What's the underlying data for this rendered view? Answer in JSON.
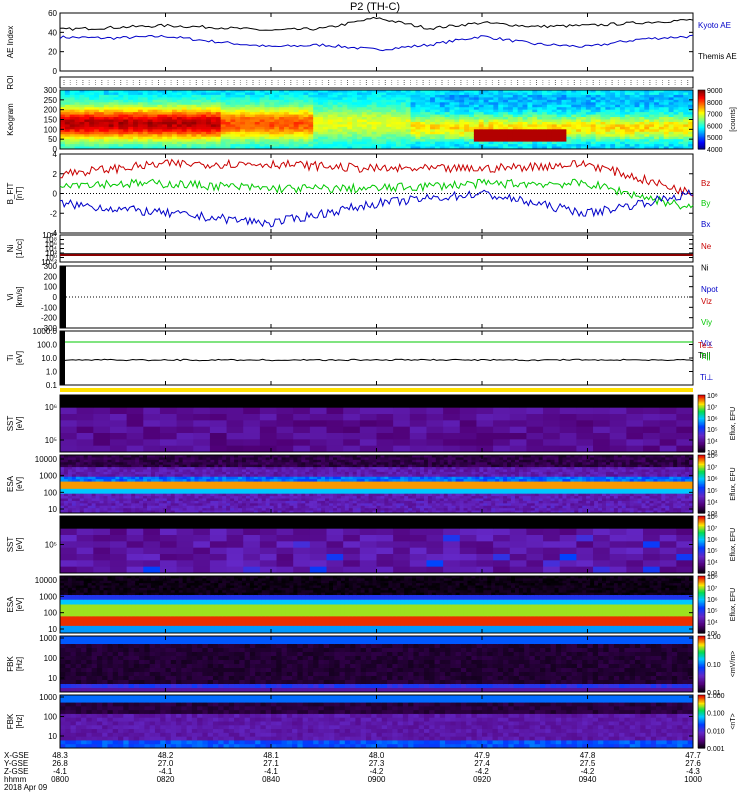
{
  "title": "P2 (TH-C)",
  "date": "2018 Apr 09",
  "time_ticks": [
    "0800",
    "0820",
    "0840",
    "0900",
    "0920",
    "0940",
    "1000"
  ],
  "orbit": {
    "row_labels": [
      "X-GSE",
      "Y-GSE",
      "Z-GSE",
      "hhmm"
    ],
    "rows": [
      [
        "48.3",
        "48.2",
        "48.1",
        "48.0",
        "47.9",
        "47.8",
        "47.7"
      ],
      [
        "26.8",
        "27.0",
        "27.1",
        "27.3",
        "27.4",
        "27.5",
        "27.6"
      ],
      [
        "-4.1",
        "-4.1",
        "-4.1",
        "-4.2",
        "-4.2",
        "-4.2",
        "-4.3"
      ]
    ]
  },
  "panels": {
    "ae": {
      "ylabel": "AE Index",
      "ticks": [
        "60",
        "40",
        "20",
        "0"
      ],
      "legend": [
        "Kyoto AE",
        "Themis AE"
      ],
      "colors": [
        "#0000c8",
        "#000000"
      ]
    },
    "roi": {
      "ylabel": "ROI"
    },
    "keogram": {
      "ylabel": "Keogram",
      "ticks": [
        "300",
        "250",
        "200",
        "150",
        "100",
        "50",
        "0"
      ],
      "bar_ticks": [
        "9000",
        "8000",
        "7000",
        "6000",
        "5000",
        "4000"
      ],
      "bar_unit": "[counts]"
    },
    "bfit": {
      "ylabel": "B_FIT",
      "unit": "[nT]",
      "ticks": [
        "4",
        "2",
        "0",
        "-2",
        "-4"
      ],
      "legend": [
        "Bz",
        "By",
        "Bx"
      ],
      "colors": [
        "#c80000",
        "#00c800",
        "#0000c8"
      ]
    },
    "ni": {
      "ylabel": "Ni",
      "unit": "[1/cc]",
      "ticks": [
        "10¹⁰",
        "10⁸",
        "10⁶",
        "10⁴",
        "10²",
        "10⁰",
        "10⁻²"
      ],
      "legend": [
        "Ne",
        "Ni",
        "Npot"
      ],
      "colors": [
        "#c80000",
        "#000000",
        "#0000c8"
      ]
    },
    "vi": {
      "ylabel": "Vi",
      "unit": "[km/s]",
      "ticks": [
        "300",
        "200",
        "100",
        "0",
        "-100",
        "-200",
        "-300"
      ],
      "legend": [
        "Viz",
        "Viy",
        "Vix"
      ],
      "colors": [
        "#c80000",
        "#00c800",
        "#0000c8"
      ]
    },
    "ti": {
      "ylabel": "Ti",
      "unit": "[eV]",
      "ticks": [
        "1000.0",
        "100.0",
        "10.0",
        "1.0",
        "0.1"
      ],
      "legend": [
        "Te||",
        "Te⊥",
        "Ti||",
        "Ti⊥"
      ],
      "colors": [
        "#000000",
        "#c80000",
        "#00c800",
        "#0000c8"
      ]
    },
    "sst_i": {
      "ylabel": "SST",
      "unit": "[eV]",
      "ticks": [
        "10⁶",
        "10⁵"
      ]
    },
    "esa_i": {
      "ylabel": "ESA",
      "unit": "[eV]",
      "ticks": [
        "10000",
        "1000",
        "100",
        "10"
      ]
    },
    "sst_e": {
      "ylabel": "SST",
      "unit": "[eV]",
      "ticks": [
        "10⁵"
      ]
    },
    "esa_e": {
      "ylabel": "ESA",
      "unit": "[eV]",
      "ticks": [
        "10000",
        "1000",
        "100",
        "10"
      ]
    },
    "fbk1": {
      "ylabel": "FBK",
      "unit": "[Hz]",
      "ticks": [
        "1000",
        "100",
        "10"
      ],
      "bar_ticks": [
        "1.00",
        "0.10",
        "0.01"
      ],
      "bar_unit": "<mV/m>"
    },
    "fbk2": {
      "ylabel": "FBK",
      "unit": "[Hz]",
      "ticks": [
        "1000",
        "100",
        "10"
      ],
      "bar_ticks": [
        "1.000",
        "0.100",
        "0.010",
        "0.001"
      ],
      "bar_unit": "<nT>"
    }
  },
  "flux_bars": {
    "sst_i": [
      "10⁸",
      "10⁷",
      "10⁶",
      "10⁵",
      "10⁴",
      "10³"
    ],
    "esa_i": [
      "10⁸",
      "10⁷",
      "10⁶",
      "10⁵",
      "10⁴",
      "10³"
    ],
    "sst_e": [
      "10⁸",
      "10⁷",
      "10⁶",
      "10⁵",
      "10⁴",
      "10³"
    ],
    "esa_e": [
      "10⁸",
      "10⁷",
      "10⁶",
      "10⁵",
      "10⁴",
      "10³"
    ],
    "unit": "Eflux, EFU"
  },
  "chart_data": {
    "type": "line",
    "title": "P2 (TH-C)",
    "time_range": [
      "0800",
      "1000"
    ],
    "series": [
      {
        "name": "Kyoto AE",
        "x": [
          "0800",
          "0810",
          "0820",
          "0830",
          "0840",
          "0850",
          "0900",
          "0910",
          "0920",
          "0930",
          "0940",
          "0950",
          "1000"
        ],
        "values": [
          35,
          34,
          36,
          30,
          25,
          27,
          22,
          27,
          36,
          28,
          25,
          33,
          36
        ]
      },
      {
        "name": "Themis AE",
        "x": [
          "0800",
          "0810",
          "0820",
          "0830",
          "0840",
          "0850",
          "0900",
          "0910",
          "0920",
          "0930",
          "0940",
          "0950",
          "1000"
        ],
        "values": [
          43,
          45,
          47,
          45,
          42,
          44,
          55,
          44,
          50,
          46,
          47,
          50,
          53
        ]
      },
      {
        "name": "Bz",
        "x": [
          "0800",
          "0820",
          "0840",
          "0900",
          "0920",
          "0940",
          "1000"
        ],
        "values": [
          2.0,
          3.0,
          3.0,
          2.5,
          2.5,
          3.0,
          0.0
        ]
      },
      {
        "name": "By",
        "x": [
          "0800",
          "0820",
          "0840",
          "0900",
          "0920",
          "0940",
          "1000"
        ],
        "values": [
          1.0,
          1.0,
          0.5,
          0.5,
          1.0,
          1.0,
          -1.5
        ]
      },
      {
        "name": "Bx",
        "x": [
          "0800",
          "0820",
          "0840",
          "0900",
          "0920",
          "0940",
          "1000"
        ],
        "values": [
          -1.0,
          -2.0,
          -3.0,
          -1.0,
          0.0,
          -2.0,
          0.0
        ]
      }
    ],
    "ylim_ae": [
      0,
      60
    ],
    "ylim_b": [
      -4,
      4
    ]
  }
}
